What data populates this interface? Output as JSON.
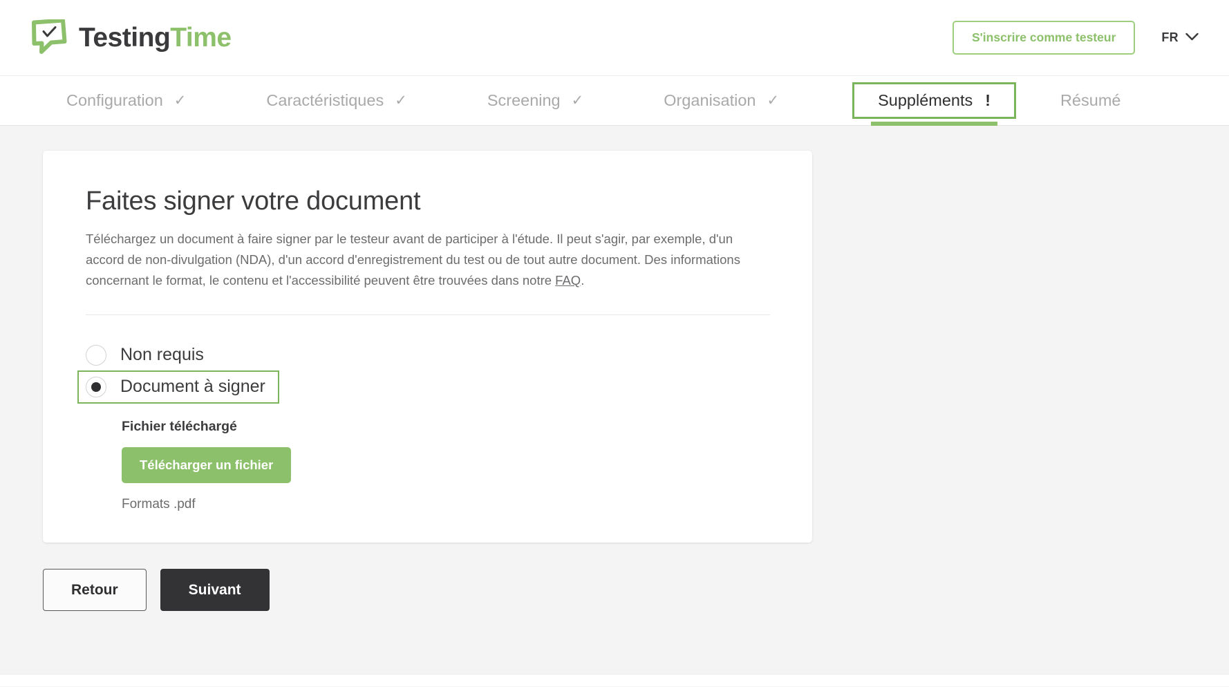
{
  "header": {
    "logo_icon": "speech-bubble-check-icon",
    "brand_first": "Testing",
    "brand_second": "Time",
    "tester_signup_label": "S'inscrire comme testeur",
    "language_code": "FR",
    "language_chevron_icon": "chevron-down-icon",
    "accent_green": "#8cc06a",
    "dark_text": "#3a3a3c"
  },
  "nav": {
    "tabs": [
      {
        "label": "Configuration",
        "marker": "✓",
        "state": "complete"
      },
      {
        "label": "Caractéristiques",
        "marker": "✓",
        "state": "complete"
      },
      {
        "label": "Screening",
        "marker": "✓",
        "state": "complete"
      },
      {
        "label": "Organisation",
        "marker": "✓",
        "state": "complete"
      },
      {
        "label": "Suppléments",
        "marker": "!",
        "state": "active"
      },
      {
        "label": "Résumé",
        "marker": "",
        "state": "upcoming"
      }
    ],
    "active_index": 4,
    "active_border_color": "#7ab55c",
    "active_underline_color": "#8cc06a"
  },
  "card": {
    "title": "Faites signer votre document",
    "description_before_link": "Téléchargez un document à faire signer par le testeur avant de participer à l'étude. Il peut s'agir, par exemple, d'un accord de non-divulgation (NDA), d'un accord d'enregistrement du test ou de tout autre document. Des informations concernant le format, le contenu et l'accessibilité peuvent être trouvées dans notre ",
    "description_link": "FAQ",
    "description_after_link": ".",
    "options": [
      {
        "label": "Non requis",
        "checked": false,
        "focused": false
      },
      {
        "label": "Document à signer",
        "checked": true,
        "focused": true
      }
    ],
    "upload": {
      "label": "Fichier téléchargé",
      "button_label": "Télécharger un fichier",
      "hint": "Formats .pdf",
      "button_color": "#8cc06a"
    }
  },
  "actions": {
    "back_label": "Retour",
    "next_label": "Suivant"
  }
}
